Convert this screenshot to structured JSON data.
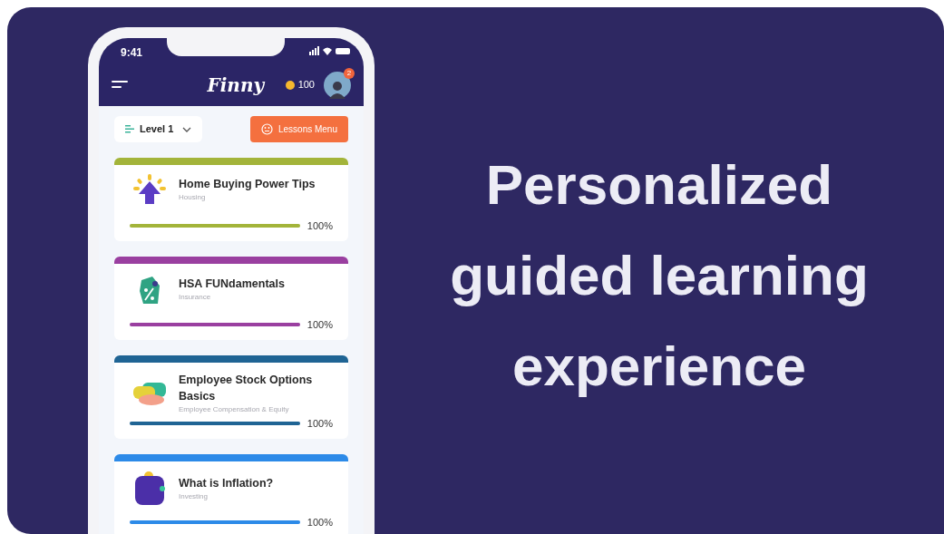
{
  "phone": {
    "status_bar": {
      "time": "9:41"
    },
    "header": {
      "logo": "Finny",
      "coins": "100",
      "notification_count": "2"
    },
    "toolbar": {
      "level_select": "Level 1",
      "lessons_button": "Lessons Menu"
    },
    "lessons": [
      {
        "title": "Home Buying Power Tips",
        "category": "Housing",
        "color": "#a3b43a",
        "kind": "arrow",
        "level": 1,
        "reading": "100%"
      },
      {
        "title": "HSA FUNdamentals",
        "category": "Insurance",
        "color": "#9a3fa0",
        "kind": "tag",
        "level": 1,
        "reading": "100%"
      },
      {
        "title": "Employee Stock Options Basics",
        "category": "Employee Compensation & Equity",
        "color": "#1f6494",
        "kind": "stack",
        "level": 1,
        "reading": "100%"
      },
      {
        "title": "What is Inflation?",
        "category": "Investing",
        "color": "#2c8ae8",
        "kind": "wallet",
        "level": 1,
        "reading": "100%"
      }
    ]
  },
  "headline": [
    "Personalized",
    "guided learning",
    "experience"
  ]
}
